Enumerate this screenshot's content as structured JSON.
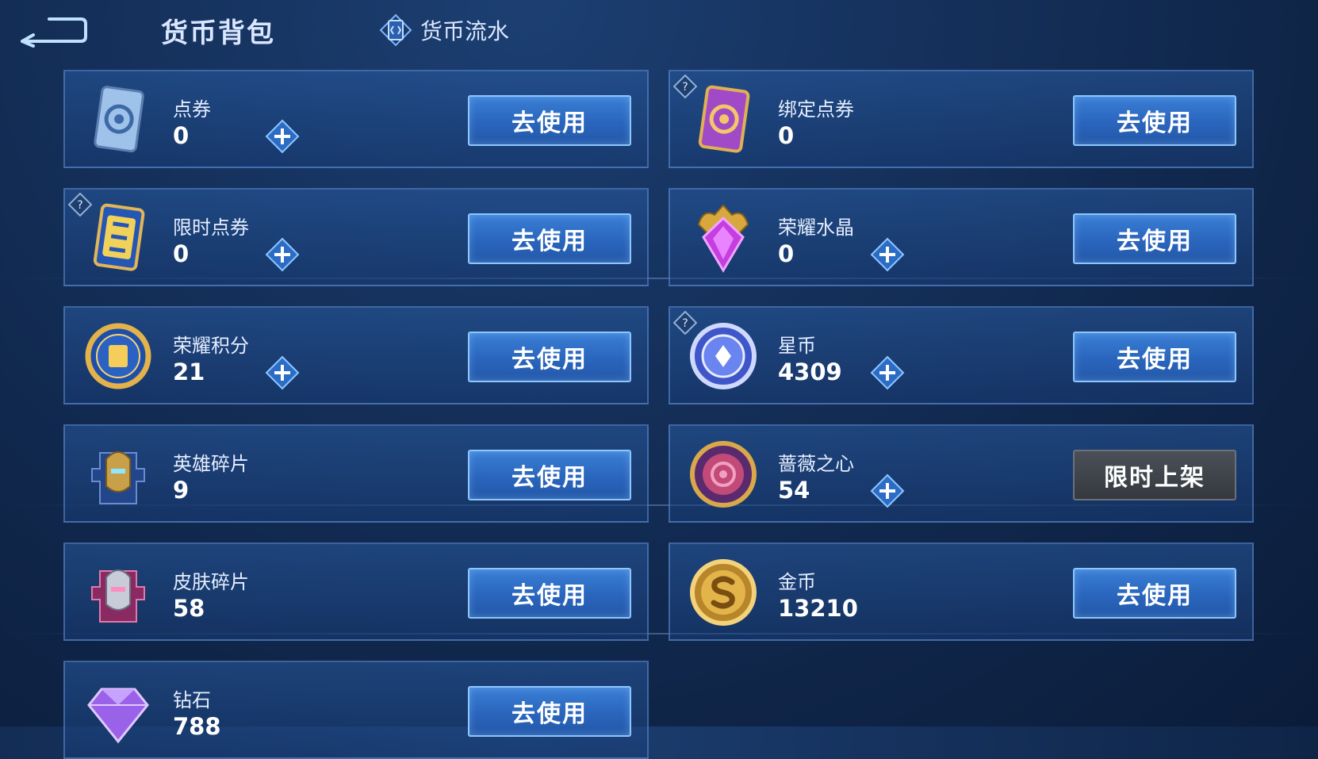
{
  "header": {
    "title": "货币背包",
    "ledger_label": "货币流水"
  },
  "cards": [
    {
      "name": "点券",
      "value": "0",
      "button": "去使用",
      "icon": "ticket-blue-icon",
      "has_plus": true,
      "has_help": false
    },
    {
      "name": "绑定点券",
      "value": "0",
      "button": "去使用",
      "icon": "ticket-purple-icon",
      "has_plus": false,
      "has_help": true
    },
    {
      "name": "限时点券",
      "value": "0",
      "button": "去使用",
      "icon": "limited-ticket-icon",
      "has_plus": true,
      "has_help": true
    },
    {
      "name": "荣耀水晶",
      "value": "0",
      "button": "去使用",
      "icon": "glory-crystal-icon",
      "has_plus": true,
      "has_help": false
    },
    {
      "name": "荣耀积分",
      "value": "21",
      "button": "去使用",
      "icon": "glory-points-icon",
      "has_plus": true,
      "has_help": false
    },
    {
      "name": "星币",
      "value": "4309",
      "button": "去使用",
      "icon": "star-coin-icon",
      "has_plus": true,
      "has_help": true
    },
    {
      "name": "英雄碎片",
      "value": "9",
      "button": "去使用",
      "icon": "hero-fragment-icon",
      "has_plus": false,
      "has_help": false
    },
    {
      "name": "蔷薇之心",
      "value": "54",
      "button": "限时上架",
      "icon": "rose-heart-icon",
      "has_plus": true,
      "has_help": false
    },
    {
      "name": "皮肤碎片",
      "value": "58",
      "button": "去使用",
      "icon": "skin-fragment-icon",
      "has_plus": false,
      "has_help": false
    },
    {
      "name": "金币",
      "value": "13210",
      "button": "去使用",
      "icon": "gold-coin-icon",
      "has_plus": false,
      "has_help": false
    },
    {
      "name": "钻石",
      "value": "788",
      "button": "去使用",
      "icon": "diamond-icon",
      "has_plus": false,
      "has_help": false
    }
  ],
  "colors": {
    "accent_button": "#2a65bd",
    "button_border": "#8cc6ff",
    "limited_button": "#3a3e45",
    "background": "#15315c"
  }
}
